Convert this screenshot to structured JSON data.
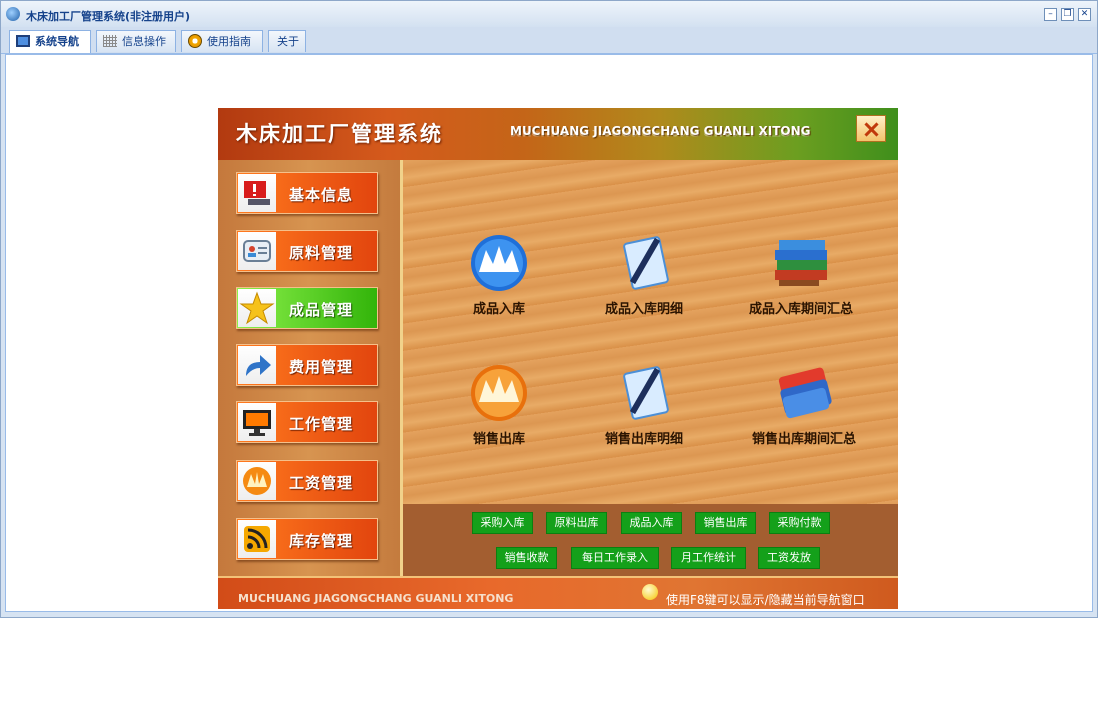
{
  "window": {
    "title": "木床加工厂管理系统(非注册用户)"
  },
  "tabs": [
    {
      "label": "系统导航",
      "icon": "monitor-icon",
      "active": true
    },
    {
      "label": "信息操作",
      "icon": "grid-icon",
      "active": false
    },
    {
      "label": "使用指南",
      "icon": "compass-icon",
      "active": false
    },
    {
      "label": "关于",
      "icon": "",
      "active": false
    }
  ],
  "panel": {
    "title_cn": "木床加工厂管理系统",
    "title_en": "MUCHUANG JIAGONGCHANG GUANLI XITONG",
    "footer_en": "MUCHUANG JIAGONGCHANG GUANLI XITONG",
    "footer_tip": "使用F8键可以显示/隐藏当前导航窗口"
  },
  "sidebar": {
    "items": [
      {
        "label": "基本信息",
        "icon": "alert-computer-icon",
        "active": false
      },
      {
        "label": "原料管理",
        "icon": "contact-card-icon",
        "active": false
      },
      {
        "label": "成品管理",
        "icon": "star-icon",
        "active": true
      },
      {
        "label": "费用管理",
        "icon": "arrow-right-icon",
        "active": false
      },
      {
        "label": "工作管理",
        "icon": "monitor-icon",
        "active": false
      },
      {
        "label": "工资管理",
        "icon": "flame-icon",
        "active": false
      },
      {
        "label": "库存管理",
        "icon": "rss-icon",
        "active": false
      }
    ]
  },
  "main": {
    "items": [
      {
        "label": "成品入库",
        "icon": "blue-crown-icon"
      },
      {
        "label": "成品入库明细",
        "icon": "pen-document-icon"
      },
      {
        "label": "成品入库期间汇总",
        "icon": "book-stack-icon"
      },
      {
        "label": "销售出库",
        "icon": "orange-crown-icon"
      },
      {
        "label": "销售出库明细",
        "icon": "pen-document-icon"
      },
      {
        "label": "销售出库期间汇总",
        "icon": "folder-stack-icon"
      }
    ]
  },
  "quick_links": {
    "row1": [
      "采购入库",
      "原料出库",
      "成品入库",
      "销售出库",
      "采购付款"
    ],
    "row2": [
      "销售收款",
      "每日工作录入",
      "月工作统计",
      "工资发放"
    ]
  },
  "colors": {
    "active_green": "#32b40a",
    "button_orange": "#e2450e",
    "quick_green": "#14a01a"
  }
}
